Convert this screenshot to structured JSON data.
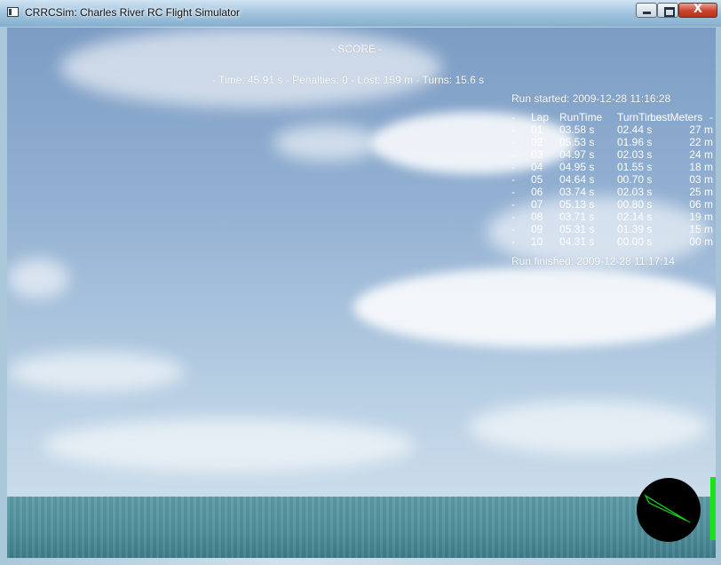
{
  "window": {
    "title": "CRRCSim: Charles River RC Flight Simulator",
    "close_glyph": "X"
  },
  "score": {
    "heading": "- SCORE -",
    "summary": "- Time: 45.91 s - Penalties: 0 - Lost: 159 m - Turns: 15.6 s",
    "run_started": "Run started: 2009-12-28 11:16:28",
    "run_finished": "Run finished: 2009-12-28 11:17:14",
    "table": {
      "headers": {
        "dash": "-",
        "lap": "Lap",
        "run": "RunTime",
        "turn": "TurnTime",
        "lost": "LostMeters",
        "end": "-"
      },
      "rows": [
        {
          "dash": "-",
          "lap": "01",
          "run": "03.58 s",
          "turn": "02.44 s",
          "lost": "27 m"
        },
        {
          "dash": "-",
          "lap": "02",
          "run": "05.53 s",
          "turn": "01.96 s",
          "lost": "22 m"
        },
        {
          "dash": "-",
          "lap": "03",
          "run": "04.97 s",
          "turn": "02.03 s",
          "lost": "24 m"
        },
        {
          "dash": "-",
          "lap": "04",
          "run": "04.95 s",
          "turn": "01.55 s",
          "lost": "18 m"
        },
        {
          "dash": "-",
          "lap": "05",
          "run": "04.64 s",
          "turn": "00.70 s",
          "lost": "03 m"
        },
        {
          "dash": "-",
          "lap": "06",
          "run": "03.74 s",
          "turn": "02.03 s",
          "lost": "25 m"
        },
        {
          "dash": "-",
          "lap": "07",
          "run": "05.13 s",
          "turn": "00.80 s",
          "lost": "06 m"
        },
        {
          "dash": "-",
          "lap": "08",
          "run": "03.71 s",
          "turn": "02.14 s",
          "lost": "19 m"
        },
        {
          "dash": "-",
          "lap": "09",
          "run": "05.31 s",
          "turn": "01.39 s",
          "lost": "15 m"
        },
        {
          "dash": "-",
          "lap": "10",
          "run": "04.31 s",
          "turn": "00.00 s",
          "lost": "00 m"
        }
      ]
    }
  },
  "colors": {
    "hud_text": "#ffffff",
    "throttle_bar": "#19e319",
    "compass_bg": "#000000",
    "compass_needle": "#16d416"
  },
  "icons": {
    "app": "crrcsim-window-icon",
    "minimize": "minimize-icon",
    "maximize": "maximize-icon",
    "close": "close-icon"
  }
}
